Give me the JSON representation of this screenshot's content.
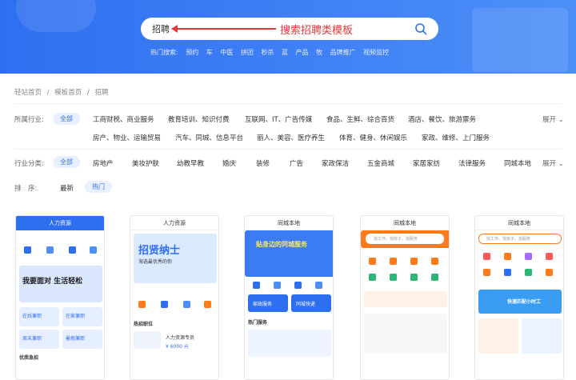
{
  "search": {
    "value": "招聘",
    "annotation": "搜索招聘类模板"
  },
  "hot_searches": {
    "label": "热门搜索:",
    "items": [
      "预约",
      "车",
      "中医",
      "拼团",
      "秒杀",
      "蓝",
      "产品",
      "牧",
      "品牌推广",
      "视频监控"
    ]
  },
  "breadcrumb": [
    "轻站首页",
    "/",
    "模板首页",
    "/",
    "招聘"
  ],
  "filters": {
    "industry_label": "所属行业:",
    "industry_all": "全部",
    "industry_row1": [
      "工商财税、商业服务",
      "教育培训、知识付费",
      "互联网、IT、广告传媒",
      "食品、生鲜、综合百货",
      "酒店、餐饮、旅游票务"
    ],
    "industry_row2": [
      "房产、物业、运输贸易",
      "汽车、同城、信息平台",
      "丽人、美容、医疗养生",
      "体育、健身、休闲娱乐",
      "家政、维修、上门服务"
    ],
    "category_label": "行业分类:",
    "category_all": "全部",
    "categories": [
      "房地产",
      "美妆护肤",
      "幼教早教",
      "婚庆",
      "装修",
      "广告",
      "家政保洁",
      "五金商城",
      "家居家纺",
      "法律服务",
      "同城本地"
    ],
    "sort_label": "排　序:",
    "sort_options": [
      "最新",
      "热门"
    ],
    "expand_label": "展开"
  },
  "templates": [
    {
      "title": "人力资源",
      "banner": "我要面对 生活轻松",
      "tiles": [
        "在线兼职",
        "在家兼职",
        "周末兼职",
        "暑假兼职"
      ],
      "section": "优质急招"
    },
    {
      "title": "人力资源",
      "banner": "招贤纳士",
      "sub": "海选最优秀的你",
      "section": "热招职位",
      "job": "人力资源专员",
      "salary": "¥ 6000 元"
    },
    {
      "title": "同城本地",
      "banner": "贴身边的同城服务",
      "tabs": [
        "家政服务",
        "同城快递"
      ],
      "section": "热门服务"
    },
    {
      "title": "同城本地",
      "search_placeholder": "找工作、找房子、找服务"
    },
    {
      "title": "同城本地",
      "search_placeholder": "找工作、找房子、找服务",
      "banner": "快速匹配小时工"
    }
  ],
  "colors": {
    "brand": "#2e6ff0",
    "annotation": "#e03a3a",
    "orange": "#ff7a1a"
  }
}
